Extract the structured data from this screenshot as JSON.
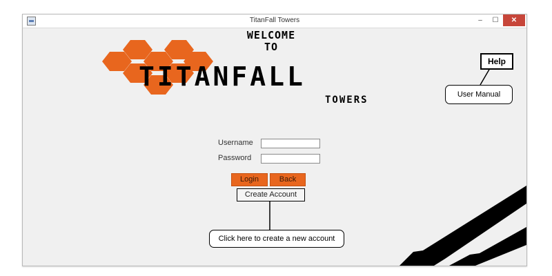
{
  "window": {
    "title": "TitanFall Towers",
    "controls": {
      "minimize": "–",
      "maximize": "☐",
      "close": "✕"
    }
  },
  "logo": {
    "welcome_line1": "WELCOME",
    "welcome_line2": "TO",
    "title": "TITANFALL",
    "subtitle": "TOWERS"
  },
  "form": {
    "username_label": "Username",
    "username_value": "",
    "password_label": "Password",
    "password_value": ""
  },
  "buttons": {
    "login": "Login",
    "back": "Back",
    "create_account": "Create Account",
    "help": "Help"
  },
  "callouts": {
    "user_manual": "User Manual",
    "create_account_hint": "Click here to create a new account"
  },
  "colors": {
    "accent": "#e8661e",
    "window_bg": "#f0f0f0",
    "close_button": "#c7463a",
    "stripes": "#000000"
  },
  "icons": {
    "app": "window-app-icon",
    "logo": "orange-hexagon-cluster"
  }
}
